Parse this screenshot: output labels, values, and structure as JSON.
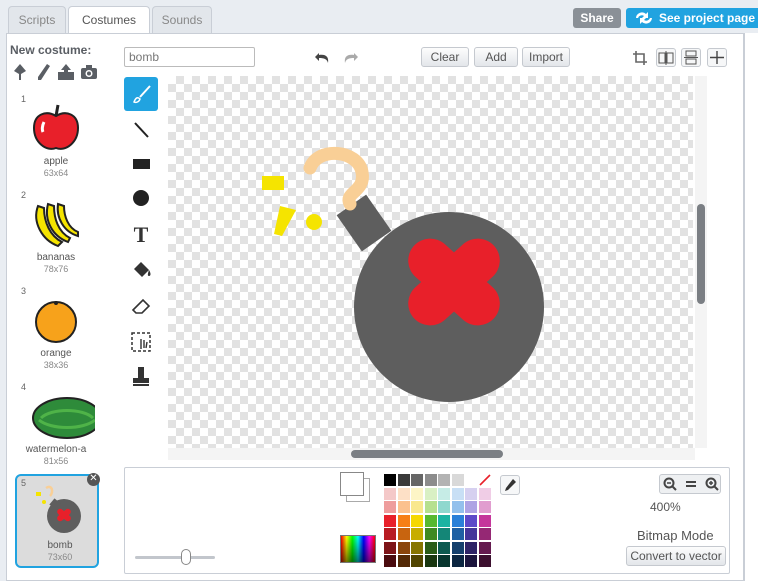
{
  "tabs": [
    {
      "label": "Scripts",
      "active": false
    },
    {
      "label": "Costumes",
      "active": true
    },
    {
      "label": "Sounds",
      "active": false
    }
  ],
  "header": {
    "share_label": "Share",
    "see_project_label": "See project page"
  },
  "new_costume": {
    "label": "New costume:",
    "icons": [
      "paint-brush-icon",
      "pencil-icon",
      "upload-icon",
      "camera-icon"
    ]
  },
  "costumes": [
    {
      "number": "1",
      "name": "apple",
      "size": "63x64",
      "icon": "apple-icon"
    },
    {
      "number": "2",
      "name": "bananas",
      "size": "78x76",
      "icon": "bananas-icon"
    },
    {
      "number": "3",
      "name": "orange",
      "size": "38x36",
      "icon": "orange-icon"
    },
    {
      "number": "4",
      "name": "watermelon-a",
      "size": "81x56",
      "icon": "watermelon-icon"
    },
    {
      "number": "5",
      "name": "bomb",
      "size": "73x60",
      "icon": "bomb-icon",
      "selected": true
    }
  ],
  "editor": {
    "costume_name": "bomb",
    "clear_label": "Clear",
    "add_label": "Add",
    "import_label": "Import",
    "tools": [
      "brush-tool-icon",
      "line-tool-icon",
      "rectangle-tool-icon",
      "ellipse-tool-icon",
      "text-tool-icon",
      "fill-tool-icon",
      "eraser-tool-icon",
      "select-tool-icon",
      "stamp-tool-icon"
    ],
    "zoom_level": "400%",
    "mode_label": "Bitmap Mode",
    "convert_label": "Convert to vector"
  },
  "colors": {
    "accent": "#21a3e0",
    "share": "#8a9097",
    "bomb_body": "#5e5e5e",
    "bomb_cross": "#e8202a",
    "spark_yellow": "#f5e400",
    "question_mark": "#f9cf96"
  },
  "palette": [
    [
      "#000000",
      "#3a3a3a",
      "#666666",
      "#8c8c8c",
      "#b3b3b3",
      "#d9d9d9",
      "#ffffff",
      "none"
    ],
    [
      "#f4c8c8",
      "#fde0c6",
      "#fdf5c6",
      "#d9f0c4",
      "#c6ece6",
      "#c8dff5",
      "#d6d0f0",
      "#f0cde6"
    ],
    [
      "#ee9d9d",
      "#fbc18e",
      "#f9e88e",
      "#b6e08f",
      "#8fd8ce",
      "#93c0ec",
      "#aea3e4",
      "#e19dcf"
    ],
    [
      "#e8202a",
      "#f67f16",
      "#f5d800",
      "#57b82f",
      "#1bb3a2",
      "#2a80d8",
      "#5d49c8",
      "#c5369b"
    ],
    [
      "#b81c22",
      "#c8640f",
      "#c7ad00",
      "#3f8a22",
      "#148677",
      "#1f60a3",
      "#45369a",
      "#952874"
    ],
    [
      "#7d1418",
      "#8a450b",
      "#877500",
      "#2a5c17",
      "#0d5a50",
      "#15406d",
      "#2f2467",
      "#651b4f"
    ],
    [
      "#4a0b0e",
      "#532906",
      "#514500",
      "#193710",
      "#08362f",
      "#0c2641",
      "#1c153d",
      "#3c102f"
    ]
  ]
}
